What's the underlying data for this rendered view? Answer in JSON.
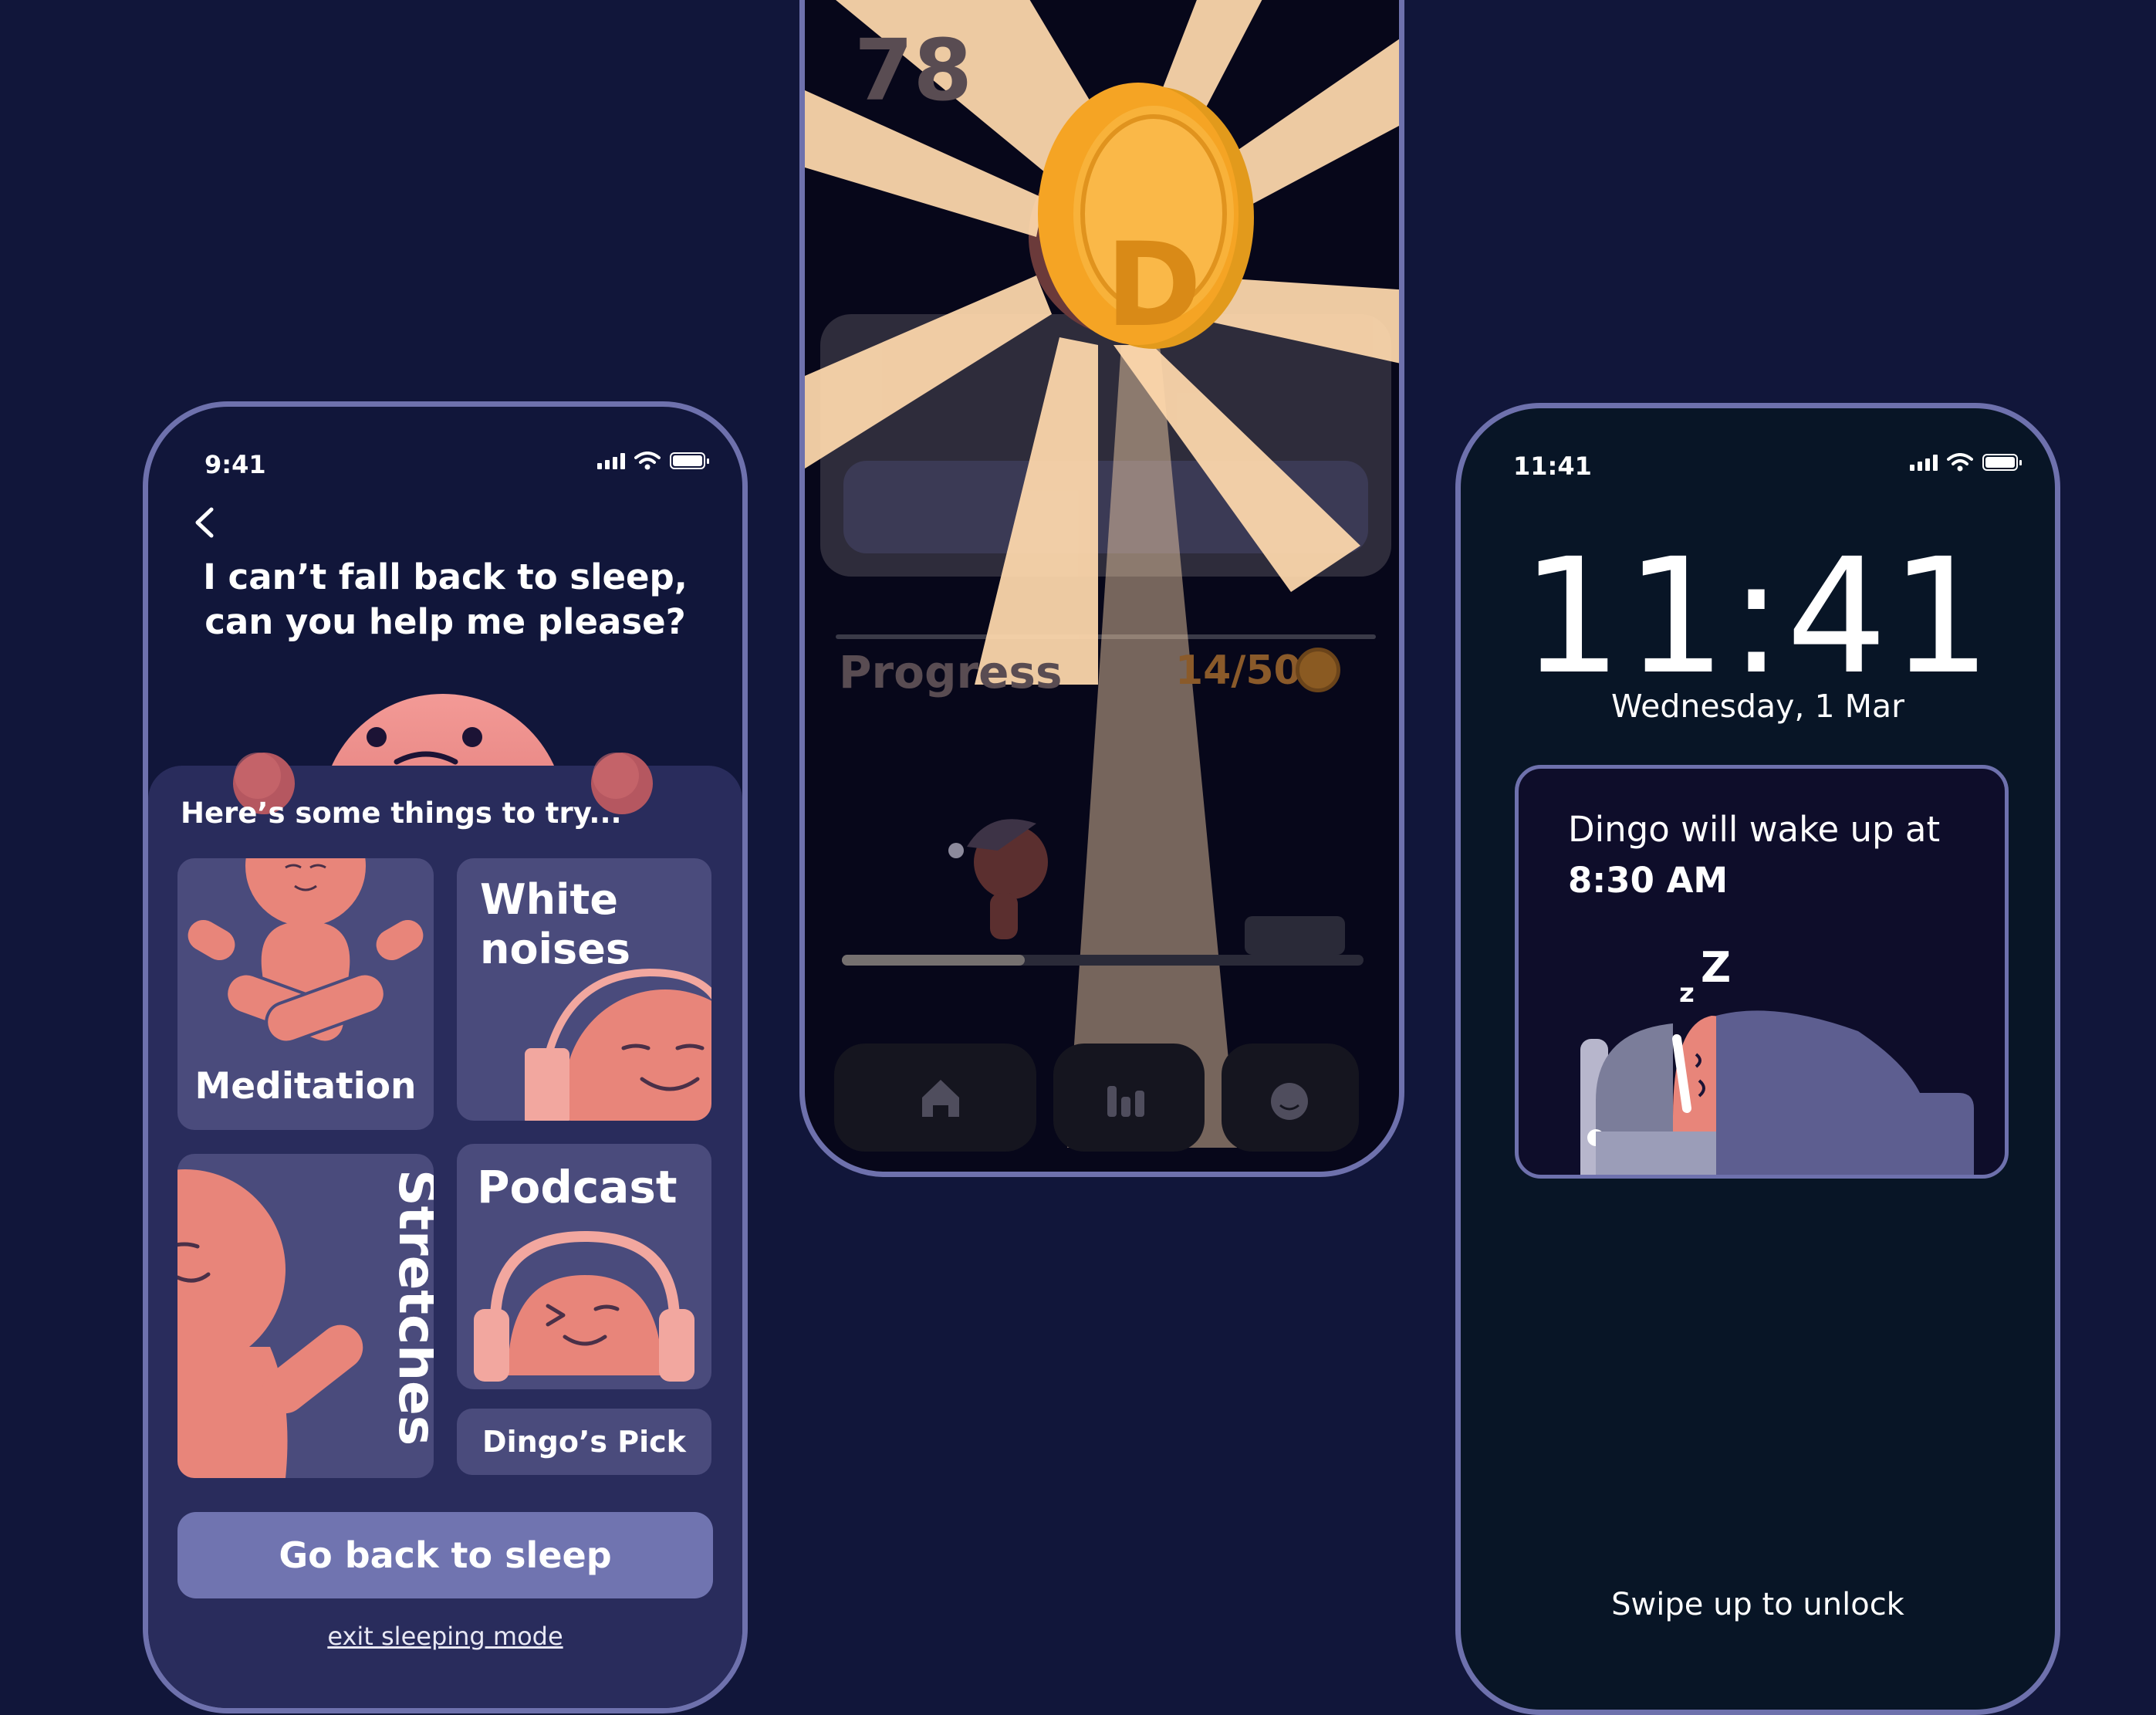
{
  "colors": {
    "background": "#11163a",
    "phone_border": "#6e71ad",
    "accent_salmon": "#e8857a",
    "card": "#4a4b7c",
    "primary_button": "#7074b0",
    "coin": "#f2a127",
    "ray": "#ffd9ad"
  },
  "left_screen": {
    "status_time": "9:41",
    "back_icon": "chevron-left-icon",
    "question_line1": "I can’t fall back to sleep,",
    "question_line2": "can you help me please?",
    "section_title": "Here’s some things to try...",
    "cards": {
      "meditation": "Meditation",
      "white_noises_line1": "White",
      "white_noises_line2": "noises",
      "stretches": "Stretches",
      "podcast": "Podcast"
    },
    "pick_label": "Dingo’s Pick",
    "primary_button": "Go back to sleep",
    "exit_link": "exit sleeping mode"
  },
  "middle_screen": {
    "top_number": "78",
    "coin_letter": "D",
    "progress_label": "Progress",
    "progress_value": "14/50",
    "progress_fraction": 0.35,
    "nav_icons": [
      "home-icon",
      "stats-icon",
      "profile-face-icon"
    ]
  },
  "right_screen": {
    "status_time": "11:41",
    "clock": "11:41",
    "date": "Wednesday, 1 Mar",
    "wake_line1": "Dingo will wake up at",
    "wake_time": "8:30 AM",
    "swipe_hint": "Swipe up to unlock"
  }
}
